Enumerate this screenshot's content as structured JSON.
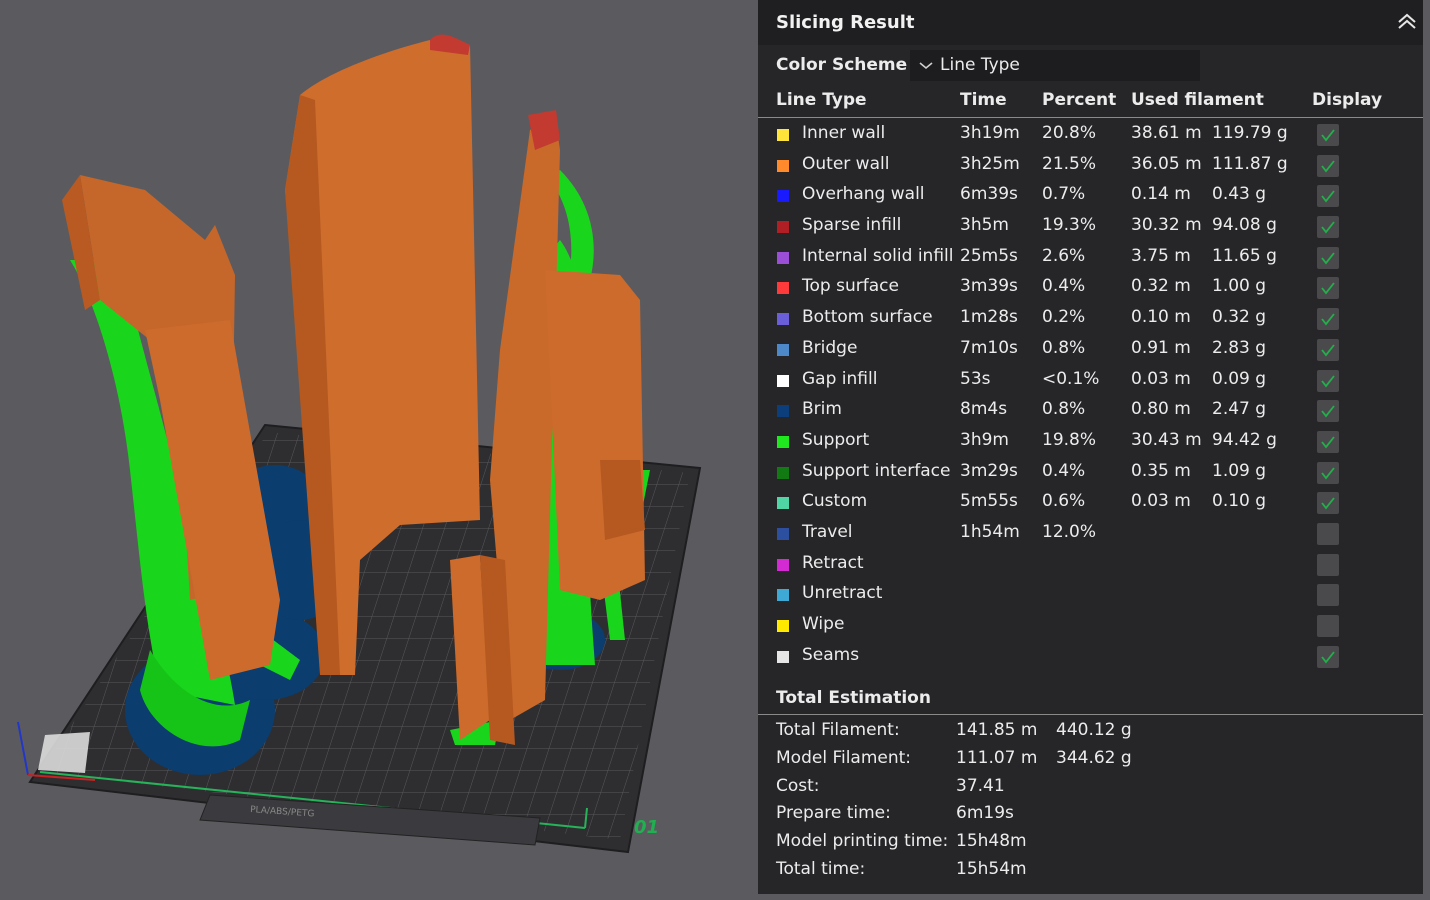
{
  "viewport": {
    "plate_label": "01",
    "plate_text": "PLA/ABS/PETG"
  },
  "panel": {
    "title": "Slicing Result",
    "color_scheme_label": "Color Scheme",
    "color_scheme_value": "Line Type",
    "columns": {
      "line_type": "Line Type",
      "time": "Time",
      "percent": "Percent",
      "used_filament": "Used filament",
      "display": "Display"
    },
    "rows": [
      {
        "label": "Inner wall",
        "color": "#ffe43a",
        "time": "3h19m",
        "percent": "20.8%",
        "length": "38.61 m",
        "weight": "119.79 g",
        "checked": true
      },
      {
        "label": "Outer wall",
        "color": "#ff8a2b",
        "time": "3h25m",
        "percent": "21.5%",
        "length": "36.05 m",
        "weight": "111.87 g",
        "checked": true
      },
      {
        "label": "Overhang wall",
        "color": "#1a1aff",
        "time": "6m39s",
        "percent": "0.7%",
        "length": "0.14 m",
        "weight": "0.43 g",
        "checked": true
      },
      {
        "label": "Sparse infill",
        "color": "#b01f24",
        "time": "3h5m",
        "percent": "19.3%",
        "length": "30.32 m",
        "weight": "94.08 g",
        "checked": true
      },
      {
        "label": "Internal solid infill",
        "color": "#9a4fd6",
        "time": "25m5s",
        "percent": "2.6%",
        "length": "3.75 m",
        "weight": "11.65 g",
        "checked": true
      },
      {
        "label": "Top surface",
        "color": "#ff3a3a",
        "time": "3m39s",
        "percent": "0.4%",
        "length": "0.32 m",
        "weight": "1.00 g",
        "checked": true
      },
      {
        "label": "Bottom surface",
        "color": "#6b5fd9",
        "time": "1m28s",
        "percent": "0.2%",
        "length": "0.10 m",
        "weight": "0.32 g",
        "checked": true
      },
      {
        "label": "Bridge",
        "color": "#4d88c9",
        "time": "7m10s",
        "percent": "0.8%",
        "length": "0.91 m",
        "weight": "2.83 g",
        "checked": true
      },
      {
        "label": "Gap infill",
        "color": "#ffffff",
        "time": "53s",
        "percent": "<0.1%",
        "length": "0.03 m",
        "weight": "0.09 g",
        "checked": true
      },
      {
        "label": "Brim",
        "color": "#0b3e7a",
        "time": "8m4s",
        "percent": "0.8%",
        "length": "0.80 m",
        "weight": "2.47 g",
        "checked": true
      },
      {
        "label": "Support",
        "color": "#1fe81f",
        "time": "3h9m",
        "percent": "19.8%",
        "length": "30.43 m",
        "weight": "94.42 g",
        "checked": true
      },
      {
        "label": "Support interface",
        "color": "#127a12",
        "time": "3m29s",
        "percent": "0.4%",
        "length": "0.35 m",
        "weight": "1.09 g",
        "checked": true
      },
      {
        "label": "Custom",
        "color": "#4fd6a4",
        "time": "5m55s",
        "percent": "0.6%",
        "length": "0.03 m",
        "weight": "0.10 g",
        "checked": true
      },
      {
        "label": "Travel",
        "color": "#2d4fa0",
        "time": "1h54m",
        "percent": "12.0%",
        "length": "",
        "weight": "",
        "checked": false
      },
      {
        "label": "Retract",
        "color": "#d42ad4",
        "time": "",
        "percent": "",
        "length": "",
        "weight": "",
        "checked": false
      },
      {
        "label": "Unretract",
        "color": "#3fa9d6",
        "time": "",
        "percent": "",
        "length": "",
        "weight": "",
        "checked": false
      },
      {
        "label": "Wipe",
        "color": "#ffea00",
        "time": "",
        "percent": "",
        "length": "",
        "weight": "",
        "checked": false
      },
      {
        "label": "Seams",
        "color": "#e6e6e6",
        "time": "",
        "percent": "",
        "length": "",
        "weight": "",
        "checked": true
      }
    ],
    "total_estimation": {
      "title": "Total Estimation",
      "items": [
        {
          "label": "Total Filament:",
          "value1": "141.85 m",
          "value2": "440.12 g"
        },
        {
          "label": "Model Filament:",
          "value1": "111.07 m",
          "value2": "344.62 g"
        },
        {
          "label": "Cost:",
          "value1": "37.41",
          "value2": ""
        },
        {
          "label": "Prepare time:",
          "value1": "6m19s",
          "value2": ""
        },
        {
          "label": "Model printing time:",
          "value1": "15h48m",
          "value2": ""
        },
        {
          "label": "Total time:",
          "value1": "15h54m",
          "value2": ""
        }
      ]
    }
  }
}
